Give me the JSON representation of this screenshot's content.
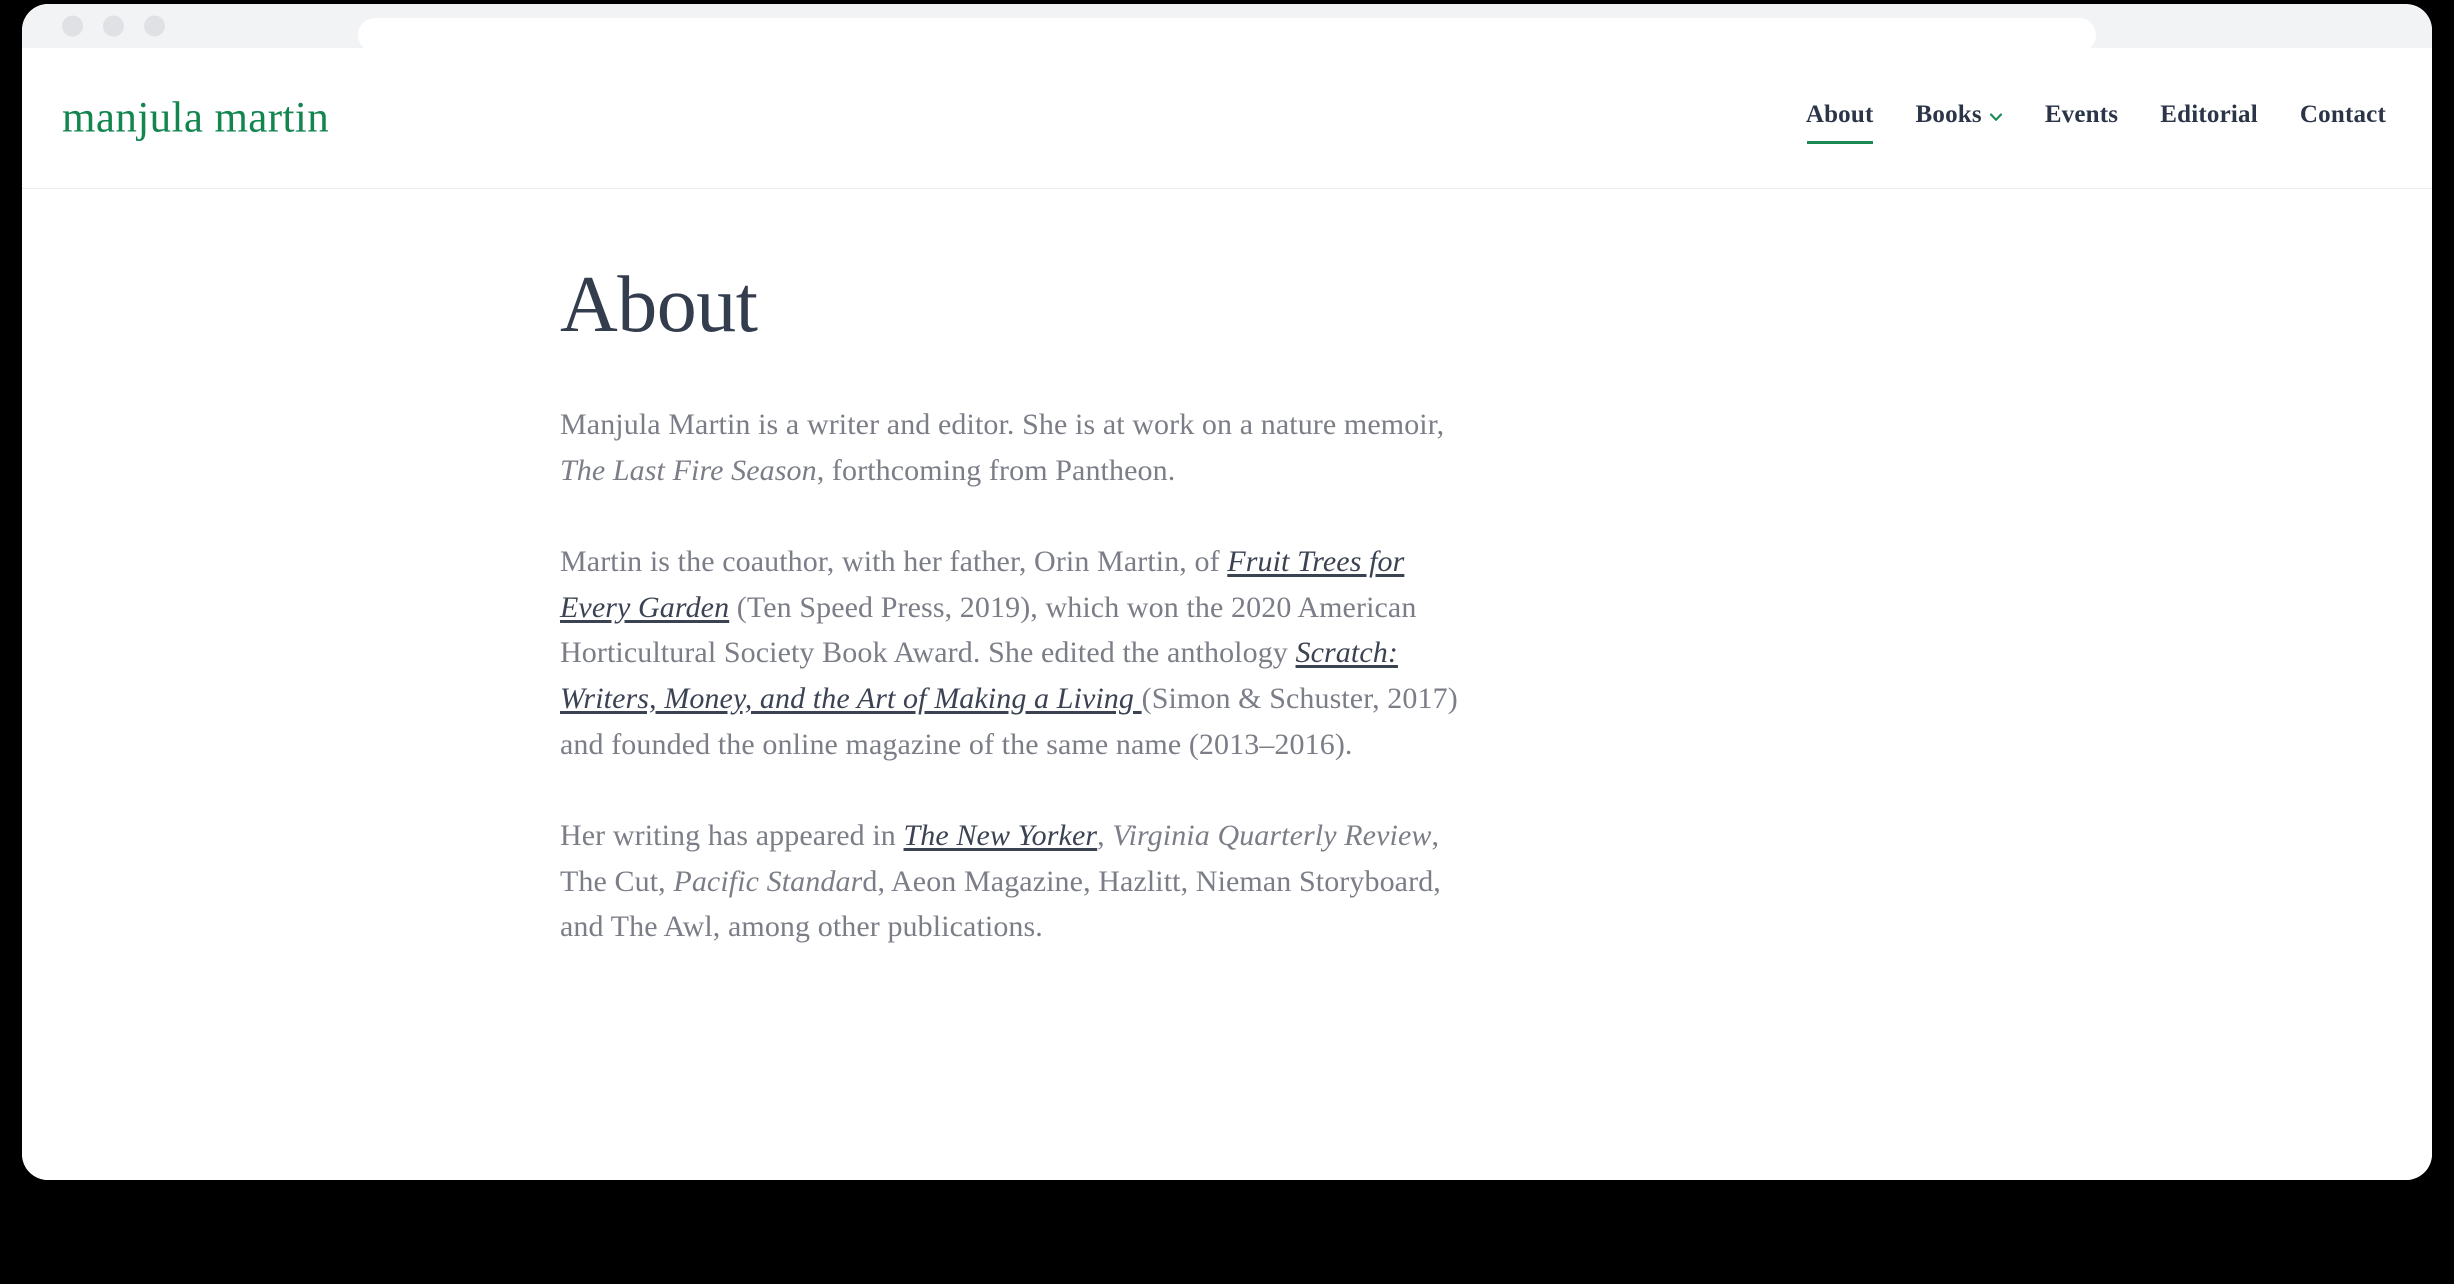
{
  "browser": {
    "traffic_lights": [
      "close",
      "minimize",
      "maximize"
    ],
    "address_bar_value": "",
    "address_bar_placeholder": ""
  },
  "colors": {
    "brand_green": "#13854f",
    "nav_text": "#2c3548",
    "heading": "#343d4e",
    "body_text": "#7b7e87",
    "link_text": "#3b4252",
    "chrome_bg": "#f2f3f5",
    "divider": "#ebebeb",
    "page_bg": "#ffffff",
    "outer_bg": "#000000"
  },
  "header": {
    "logo": "manjula martin",
    "nav": [
      {
        "label": "About",
        "active": true,
        "has_dropdown": false
      },
      {
        "label": "Books",
        "active": false,
        "has_dropdown": true,
        "dropdown_icon": "chevron-down-icon"
      },
      {
        "label": "Events",
        "active": false,
        "has_dropdown": false
      },
      {
        "label": "Editorial",
        "active": false,
        "has_dropdown": false
      },
      {
        "label": "Contact",
        "active": false,
        "has_dropdown": false
      }
    ]
  },
  "main": {
    "title": "About",
    "paragraphs": {
      "p1": {
        "part1": "Manjula Martin is a writer and editor. She is at work on a nature memoir, ",
        "italic1": "The Last Fire Season",
        "part2": ", forthcoming from Pantheon."
      },
      "p2": {
        "part1": "Martin is the coauthor, with her father, Orin Martin, of ",
        "link1": "Fruit Trees for Every Garden",
        "part2": " (Ten Speed Press, 2019), which won the 2020 American Horticultural Society Book Award. She edited the anthology ",
        "link2": "Scratch: Writers, Money, and the Art of Making a Living ",
        "part3": "(Simon & Schuster, 2017) and founded the online magazine of the same name (2013–2016)."
      },
      "p3": {
        "part1": "Her writing has appeared in ",
        "link1": "The New Yorker",
        "part2": ", ",
        "italic1": "Virginia Quarterly Review",
        "part3": ", The Cut, ",
        "italic2": "Pacific Standar",
        "part4": "d, Aeon Magazine, Hazlitt, Nieman Storyboard, and The Awl, among other publications."
      }
    }
  }
}
